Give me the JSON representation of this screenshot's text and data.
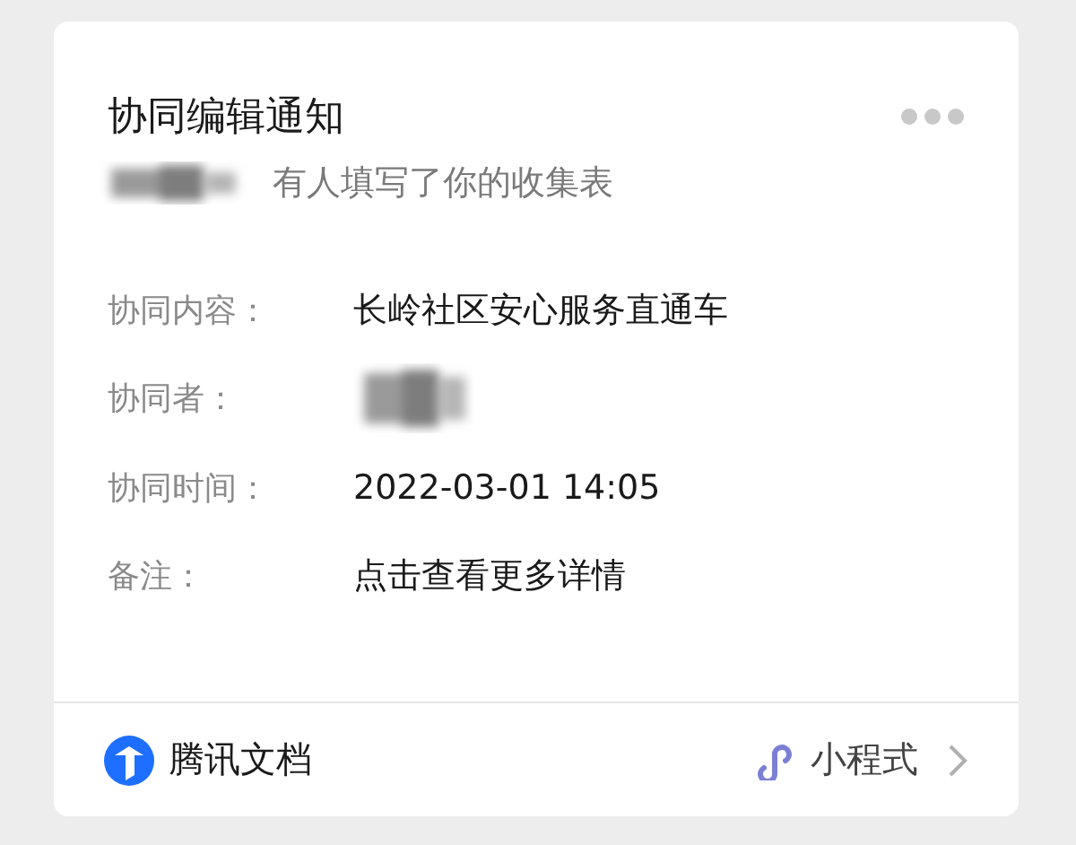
{
  "card": {
    "title": "协同编辑通知",
    "subtitle": "有人填写了你的收集表",
    "fields": [
      {
        "label": "协同内容：",
        "kind": "text",
        "value": "长岭社区安心服务直通车"
      },
      {
        "label": "协同者：",
        "kind": "redacted"
      },
      {
        "label": "协同时间：",
        "kind": "text",
        "value": "2022-03-01 14:05"
      },
      {
        "label": "备注：",
        "kind": "text",
        "value": "点击查看更多详情"
      }
    ]
  },
  "footer": {
    "source": "腾讯文档",
    "app_type": "小程式"
  }
}
